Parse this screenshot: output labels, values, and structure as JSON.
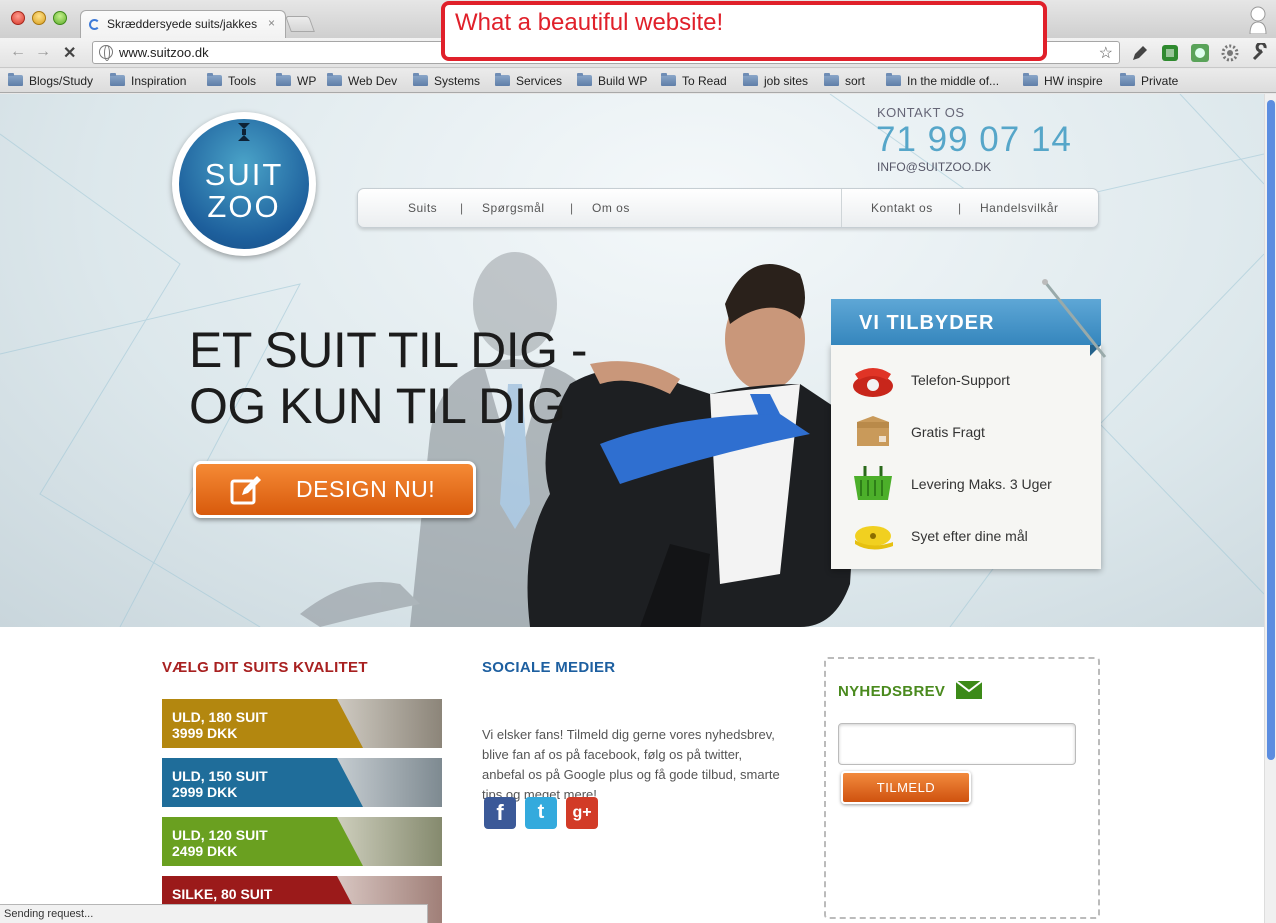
{
  "browser": {
    "tab_title": "Skræddersyede suits/jakkesæt",
    "tab_close": "×",
    "url": "www.suitzoo.dk",
    "bookmarks": [
      "Blogs/Study",
      "Inspiration",
      "Tools",
      "WP",
      "Web Dev",
      "Systems",
      "Services",
      "Build WP",
      "To Read",
      "job sites",
      "sort",
      "In the middle of...",
      "HW inspire",
      "Private"
    ],
    "status": "Sending request..."
  },
  "annotation": {
    "text": "What a beautiful website!"
  },
  "site": {
    "logo": {
      "line1": "SUIT",
      "line2": "ZOO"
    },
    "contact": {
      "label": "KONTAKT OS",
      "phone": "71 99 07 14",
      "email": "INFO@SUITZOO.DK"
    },
    "nav": {
      "left": [
        "Suits",
        "Spørgsmål",
        "Om os"
      ],
      "right": [
        "Kontakt os",
        "Handelsvilkår"
      ],
      "separator": "|"
    },
    "hero": {
      "headline_1": "ET SUIT TIL DIG -",
      "headline_2": "OG KUN TIL DIG",
      "cta": "DESIGN NU!"
    },
    "offer": {
      "title": "VI TILBYDER",
      "items": [
        {
          "label": "Telefon-Support",
          "icon": "telephone-icon"
        },
        {
          "label": "Gratis Fragt",
          "icon": "box-icon"
        },
        {
          "label": "Levering Maks. 3 Uger",
          "icon": "basket-icon"
        },
        {
          "label": "Syet efter dine mål",
          "icon": "tape-measure-icon"
        }
      ]
    },
    "quality": {
      "title": "VÆLG DIT SUITS KVALITET",
      "items": [
        {
          "name": "ULD, 180 SUIT",
          "price": "3999 DKK",
          "color": "#b3870f"
        },
        {
          "name": "ULD, 150 SUIT",
          "price": "2999 DKK",
          "color": "#1f6d9a"
        },
        {
          "name": "ULD, 120 SUIT",
          "price": "2499 DKK",
          "color": "#6aa020"
        },
        {
          "name": "SILKE, 80 SUIT",
          "price": "",
          "color": "#9b1a1a"
        }
      ]
    },
    "social": {
      "title": "SOCIALE MEDIER",
      "text": "Vi elsker fans! Tilmeld dig gerne vores nyhedsbrev, blive fan af os på facebook, følg os på twitter, anbefal os på Google plus og få gode tilbud, smarte tips og meget mere!",
      "icons": [
        {
          "name": "facebook-icon",
          "glyph": "f",
          "color": "#3b5998"
        },
        {
          "name": "twitter-icon",
          "glyph": "t",
          "color": "#33aadd"
        },
        {
          "name": "google-plus-icon",
          "glyph": "g+",
          "color": "#d23b27"
        }
      ]
    },
    "newsletter": {
      "title": "NYHEDSBREV",
      "button": "TILMELD",
      "input_value": ""
    }
  },
  "colors": {
    "accent_orange": "#e06a15",
    "title_red": "#a82020",
    "title_blue": "#1d5fa0",
    "title_green": "#4a8a1e"
  }
}
